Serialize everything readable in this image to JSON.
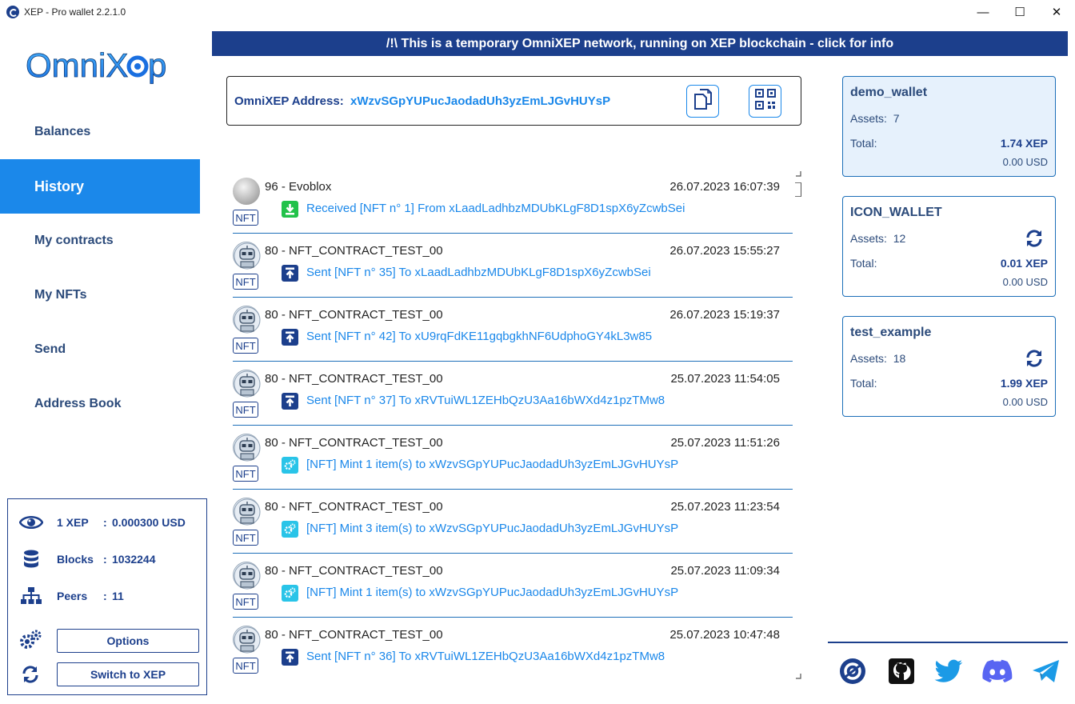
{
  "window": {
    "title": "XEP - Pro wallet 2.2.1.0",
    "controls": {
      "minimize": "—",
      "maximize": "☐",
      "close": "✕"
    }
  },
  "logo": {
    "text_a": "OmniX",
    "text_b": "p"
  },
  "nav": [
    {
      "label": "Balances",
      "active": false
    },
    {
      "label": "History",
      "active": true
    },
    {
      "label": "My contracts",
      "active": false
    },
    {
      "label": "My NFTs",
      "active": false
    },
    {
      "label": "Send",
      "active": false
    },
    {
      "label": "Address Book",
      "active": false
    }
  ],
  "status": {
    "price": {
      "label": "1 XEP",
      "value": "0.000300 USD"
    },
    "blocks": {
      "label": "Blocks",
      "value": "1032244"
    },
    "peers": {
      "label": "Peers",
      "value": "11"
    },
    "colon": ":",
    "options_label": "Options",
    "switch_label": "Switch to XEP"
  },
  "banner": "/!\\ This is a temporary OmniXEP network, running on XEP blockchain - click for info",
  "address": {
    "label": "OmniXEP Address:",
    "value": "xWzvSGpYUPucJaodadUh3yzEmLJGvHUYsP"
  },
  "history": [
    {
      "contract": "96 - Evoblox",
      "date": "26.07.2023 16:07:39",
      "type": "received",
      "badge": "NFT",
      "desc": "Received [NFT n° 1] From xLaadLadhbzMDUbKLgF8D1spX6yZcwbSei",
      "avatar": "gray"
    },
    {
      "contract": "80 - NFT_CONTRACT_TEST_00",
      "date": "26.07.2023 15:55:27",
      "type": "sent",
      "badge": "NFT",
      "desc": "Sent [NFT n° 35] To xLaadLadhbzMDUbKLgF8D1spX6yZcwbSei",
      "avatar": "robot"
    },
    {
      "contract": "80 - NFT_CONTRACT_TEST_00",
      "date": "26.07.2023 15:19:37",
      "type": "sent",
      "badge": "NFT",
      "desc": "Sent [NFT n° 42] To xU9rqFdKE11gqbgkhNF6UdphoGY4kL3w85",
      "avatar": "robot"
    },
    {
      "contract": "80 - NFT_CONTRACT_TEST_00",
      "date": "25.07.2023 11:54:05",
      "type": "sent",
      "badge": "NFT",
      "desc": "Sent [NFT n° 37] To xRVTuiWL1ZEHbQzU3Aa16bWXd4z1pzTMw8",
      "avatar": "robot"
    },
    {
      "contract": "80 - NFT_CONTRACT_TEST_00",
      "date": "25.07.2023 11:51:26",
      "type": "mint",
      "badge": "NFT",
      "desc": "[NFT] Mint 1 item(s) to xWzvSGpYUPucJaodadUh3yzEmLJGvHUYsP",
      "avatar": "robot"
    },
    {
      "contract": "80 - NFT_CONTRACT_TEST_00",
      "date": "25.07.2023 11:23:54",
      "type": "mint",
      "badge": "NFT",
      "desc": "[NFT] Mint 3 item(s) to xWzvSGpYUPucJaodadUh3yzEmLJGvHUYsP",
      "avatar": "robot"
    },
    {
      "contract": "80 - NFT_CONTRACT_TEST_00",
      "date": "25.07.2023 11:09:34",
      "type": "mint",
      "badge": "NFT",
      "desc": "[NFT] Mint 1 item(s) to xWzvSGpYUPucJaodadUh3yzEmLJGvHUYsP",
      "avatar": "robot"
    },
    {
      "contract": "80 - NFT_CONTRACT_TEST_00",
      "date": "25.07.2023 10:47:48",
      "type": "sent",
      "badge": "NFT",
      "desc": "Sent [NFT n° 36] To xRVTuiWL1ZEHbQzU3Aa16bWXd4z1pzTMw8",
      "avatar": "robot"
    }
  ],
  "wallets": [
    {
      "name": "demo_wallet",
      "assets_label": "Assets:",
      "assets": "7",
      "total_label": "Total:",
      "total_xep": "1.74 XEP",
      "total_usd": "0.00 USD",
      "active": true,
      "refresh": false
    },
    {
      "name": "ICON_WALLET",
      "assets_label": "Assets:",
      "assets": "12",
      "total_label": "Total:",
      "total_xep": "0.01 XEP",
      "total_usd": "0.00 USD",
      "active": false,
      "refresh": true
    },
    {
      "name": "test_example",
      "assets_label": "Assets:",
      "assets": "18",
      "total_label": "Total:",
      "total_xep": "1.99 XEP",
      "total_usd": "0.00 USD",
      "active": false,
      "refresh": true
    }
  ],
  "social": [
    "omnixep-icon",
    "github-icon",
    "twitter-icon",
    "discord-icon",
    "telegram-icon"
  ],
  "colors": {
    "navy": "#1c3f8c",
    "accent": "#1b88ea",
    "received": "#22c24a",
    "mint": "#29c4e8"
  }
}
